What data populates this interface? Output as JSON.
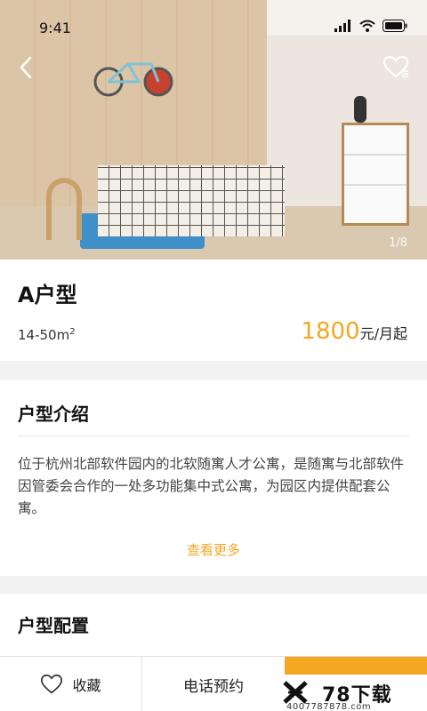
{
  "status_bar": {
    "time": "9:41"
  },
  "hero": {
    "page_counter": "1/8"
  },
  "unit": {
    "title": "A户型",
    "area": "14-50m",
    "area_sup": "2",
    "price": "1800",
    "price_unit": "元/月起"
  },
  "intro": {
    "heading": "户型介绍",
    "text": "位于杭州北部软件园内的北软随寓人才公寓，是随寓与北部软件因管委会合作的一处多功能集中式公寓，为园区内提供配套公寓。",
    "more": "查看更多"
  },
  "config": {
    "heading": "户型配置"
  },
  "bottom_bar": {
    "favorite": "收藏",
    "call": "电话预约"
  },
  "watermark": {
    "brand": "78下载",
    "phone": "4007787878.com"
  },
  "colors": {
    "accent": "#f5a623"
  },
  "icons": [
    "back-arrow-icon",
    "heart-icon",
    "signal-icon",
    "wifi-icon",
    "battery-icon"
  ]
}
